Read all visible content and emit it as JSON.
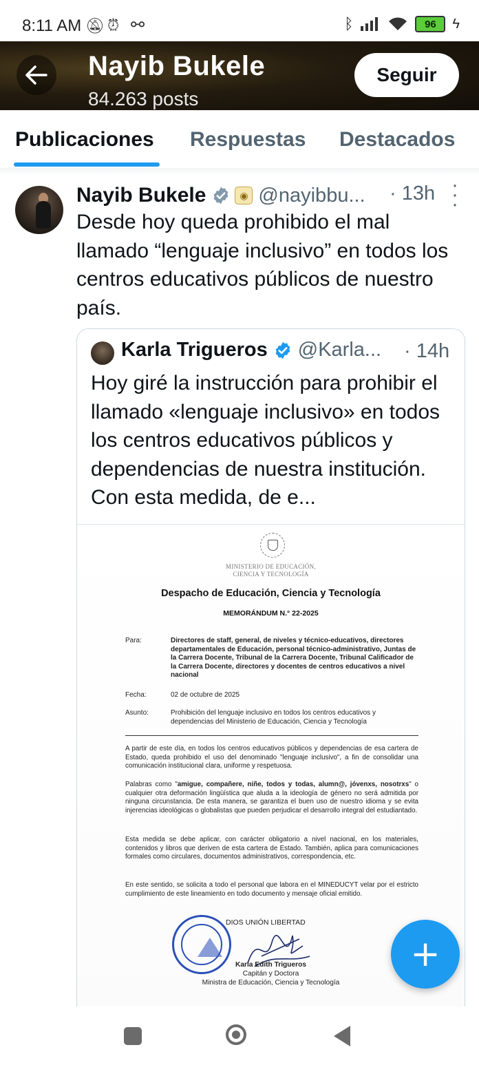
{
  "status_bar": {
    "time": "8:11 AM",
    "left_icons": [
      "bell-off-icon",
      "alarm-icon",
      "voicemail-icon"
    ],
    "right_icons": [
      "bluetooth-icon",
      "signal-icon",
      "wifi-icon"
    ],
    "battery": "96"
  },
  "header": {
    "title": "Nayib Bukele",
    "posts_count": "84.263 posts",
    "follow_label": "Seguir"
  },
  "tabs": [
    {
      "label": "Publicaciones",
      "active": true
    },
    {
      "label": "Respuestas",
      "active": false
    },
    {
      "label": "Destacados",
      "active": false
    }
  ],
  "post": {
    "author": "Nayib Bukele",
    "handle": "@nayibbu...",
    "time": "· 13h",
    "text": "Desde hoy queda prohibido el mal llamado “lenguaje inclusivo” en todos los centros educativos públicos de nuestro país.",
    "quote": {
      "author": "Karla Trigueros",
      "handle": "@Karla...",
      "time": "· 14h",
      "text": "Hoy giré la instrucción para prohibir el llamado «lenguaje inclusivo» en todos los centros educativos públicos y dependencias de nuestra institución. Con esta medida, de e...",
      "document": {
        "ministry": "MINISTERIO DE EDUCACIÓN,\nCIENCIA Y TECNOLOGÍA",
        "title": "Despacho de Educación, Ciencia y Tecnología",
        "memo_number": "MEMORÁNDUM N.° 22-2025",
        "para_label": "Para:",
        "para_value": "Directores de staff, general, de niveles y técnico-educativos, directores departamentales de Educación, personal técnico-administrativo, Juntas de la Carrera Docente, Tribunal de la Carrera Docente, Tribunal Calificador de la Carrera Docente, directores y docentes de centros educativos a nivel nacional",
        "fecha_label": "Fecha:",
        "fecha_value": "02 de octubre de 2025",
        "asunto_label": "Asunto:",
        "asunto_value": "Prohibición del lenguaje inclusivo en todos los centros educativos y dependencias del Ministerio de Educación, Ciencia y Tecnología",
        "p1": "A partir de este día, en todos los centros educativos públicos y dependencias de esa cartera de Estado, queda prohibido el uso del denominado \"lenguaje inclusivo\", a fin de consolidar una comunicación institucional clara, uniforme y respetuosa.",
        "p2_prefix": "Palabras como \"",
        "p2_bold": "amigue, compañere, niñe, todos y todas, alumn@, jóvenxs, nosotrxs",
        "p2_suffix": "\" o cualquier otra deformación lingüística que aluda a la ideología de género no será admitida por ninguna circunstancia. De esta manera, se garantiza el buen uso de nuestro idioma y se evita injerencias ideológicas o globalistas que pueden perjudicar el desarrollo integral del estudiantado.",
        "p3": "Esta medida se debe aplicar, con carácter obligatorio a nivel nacional, en los materiales, contenidos y libros que deriven de esta cartera de Estado. También, aplica para comunicaciones formales como circulares, documentos administrativos, correspondencia, etc.",
        "p4": "En este sentido, se solicita a todo el personal que labora en el MINEDUCYT velar por el estricto cumplimiento de este lineamiento en todo documento y mensaje oficial emitido.",
        "closing": "DIOS UNIÓN LIBERTAD",
        "signer_name": "Karla Edith Trigueros",
        "signer_rank": "Capitán y Doctora",
        "signer_title": "Ministra de Educación, Ciencia y Tecnología"
      }
    }
  },
  "fab": {
    "icon": "plus-icon",
    "label": "+"
  },
  "colors": {
    "accent": "#1d9bf0",
    "text": "#0f1419",
    "muted": "#536471"
  }
}
